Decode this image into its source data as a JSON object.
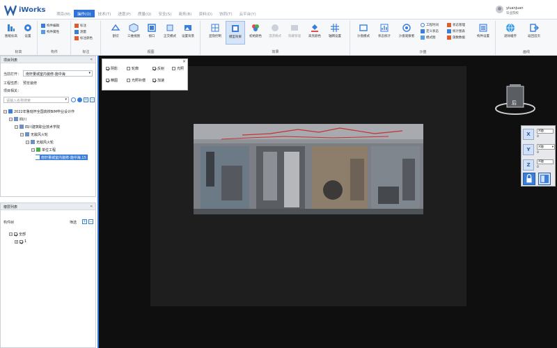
{
  "app": {
    "name": "iWorks"
  },
  "menu": [
    "项目(M)",
    "操作(O)",
    "技术(T)",
    "进度(P)",
    "质量(Q)",
    "安全(S)",
    "商务(B)",
    "资料(D)",
    "协同(T)",
    "云平台(Y)"
  ],
  "menu_active_index": 1,
  "user": {
    "name": "yiuanjuan",
    "role": "毕业院校"
  },
  "ribbon": {
    "g1": {
      "label": "标高",
      "btn1": "图纸标高",
      "btn2": "设置"
    },
    "g2": {
      "label": "构件",
      "item1": "构件编辑",
      "item2": "构件属性"
    },
    "g3": {
      "label": "标注",
      "item1": "标注",
      "item2": "测量",
      "item3": "标注颜色"
    },
    "g4": {
      "label": "视图",
      "btns": [
        "剖切",
        "三维视图",
        "视口",
        "正交模式",
        "设置背景"
      ]
    },
    "g5": {
      "label": "效果",
      "btns": [
        "显隐控制",
        "模型效果",
        "初始颜色",
        "漫游模式",
        "隐藏管理",
        "高亮颜色",
        "轴网设置"
      ]
    },
    "g6": {
      "label": "沙盘",
      "btns": [
        "沙盘模式",
        "状态统计",
        "沙盘观察者"
      ],
      "items": [
        "工程时间",
        "定义状态",
        "模式图",
        "状态管理",
        "统计图表",
        "施数数据"
      ],
      "btn_last": "构件设置"
    },
    "g7": {
      "label": "画线",
      "btns": [
        "退除缓存",
        "返回首页"
      ]
    }
  },
  "project_panel": {
    "title": "项目列表",
    "current_label": "当前打开：",
    "current_value": "南轩量城室内装修-施中海",
    "type_label": "工程性质：",
    "type_value": "预览装修",
    "related_label": "项目相关：",
    "search_placeholder": "请输入名称搜索",
    "tree": [
      "2022年鲁班杯全国高校BIM毕业设计作",
      "四川",
      "四川建筑职业技术学院",
      "无敌风火轮",
      "无敌风火轮",
      "单位工程",
      "南轩量城室内装修-施中海.15"
    ]
  },
  "component_panel": {
    "title": "楼层列表",
    "tree_label": "构件树",
    "filter_label": "筛选",
    "tree": [
      "全部",
      "1"
    ]
  },
  "render_options": [
    "阴影",
    "轮廓",
    "反射",
    "光照",
    "精图",
    "光照补偿",
    "加速"
  ],
  "render_options_checked": [
    true,
    false,
    true,
    false,
    true,
    false,
    true
  ],
  "navcube": {
    "face": "后"
  },
  "axis_panel": {
    "x_field": "X轴",
    "x_value": "0",
    "y_select": "X轴",
    "y_value": "0",
    "z_field": "X轴",
    "z_value": "0"
  }
}
